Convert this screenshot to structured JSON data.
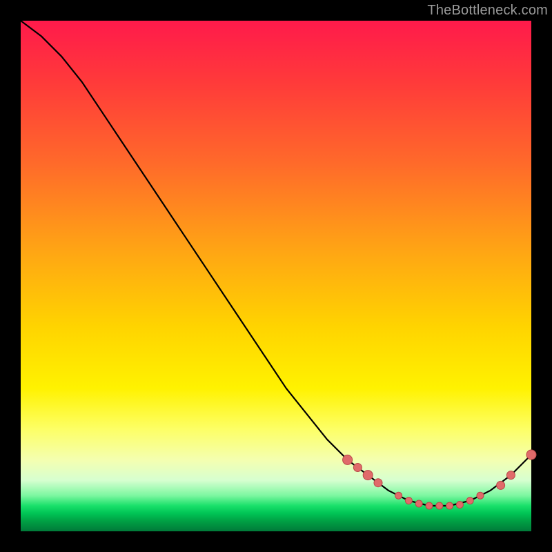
{
  "watermark": "TheBottleneck.com",
  "chart_data": {
    "type": "line",
    "title": "",
    "xlabel": "",
    "ylabel": "",
    "xlim": [
      0,
      100
    ],
    "ylim": [
      0,
      100
    ],
    "grid": false,
    "series": [
      {
        "name": "curve",
        "x": [
          0,
          4,
          8,
          12,
          16,
          20,
          24,
          28,
          32,
          36,
          40,
          44,
          48,
          52,
          56,
          60,
          64,
          68,
          72,
          76,
          80,
          84,
          88,
          92,
          96,
          100
        ],
        "y": [
          100,
          97,
          93,
          88,
          82,
          76,
          70,
          64,
          58,
          52,
          46,
          40,
          34,
          28,
          23,
          18,
          14,
          11,
          8,
          6,
          5,
          5,
          6,
          8,
          11,
          15
        ]
      }
    ],
    "markers": {
      "name": "dots",
      "x": [
        64,
        66,
        68,
        70,
        74,
        76,
        78,
        80,
        82,
        84,
        86,
        88,
        90,
        94,
        96,
        100
      ],
      "y": [
        14,
        12.5,
        11,
        9.5,
        7,
        6,
        5.4,
        5,
        5,
        5,
        5.2,
        6,
        7,
        9,
        11,
        15
      ],
      "r": [
        7,
        6,
        7,
        6,
        5,
        5,
        5,
        5,
        5,
        5,
        5,
        5,
        5,
        6,
        6,
        7
      ]
    }
  }
}
